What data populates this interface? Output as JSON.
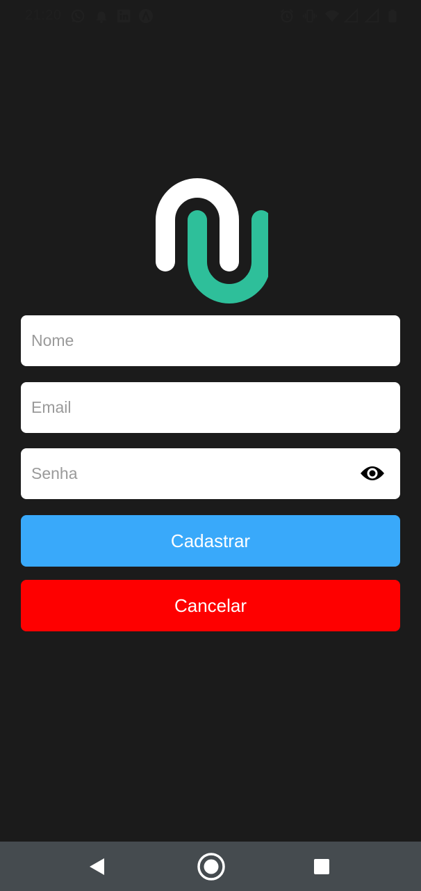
{
  "status_bar": {
    "time": "21:20",
    "left_icons": [
      "whatsapp-icon",
      "notification-bell-icon",
      "linkedin-icon",
      "app-a-icon"
    ],
    "right_icons": [
      "alarm-icon",
      "vibrate-icon",
      "wifi-icon",
      "signal-icon",
      "signal-icon",
      "battery-icon"
    ]
  },
  "logo": {
    "icon": "app-logo-icon",
    "colors": {
      "white_arch": "#ffffff",
      "green_u": "#2ebf9a"
    }
  },
  "form": {
    "name_placeholder": "Nome",
    "email_placeholder": "Email",
    "password_placeholder": "Senha",
    "name_value": "",
    "email_value": "",
    "password_value": "",
    "show_password_icon": "eye-icon"
  },
  "buttons": {
    "register_label": "Cadastrar",
    "cancel_label": "Cancelar",
    "register_color": "#39a9fa",
    "cancel_color": "#fe0000"
  },
  "nav_bar": {
    "back_icon": "back-triangle-icon",
    "home_icon": "home-circle-icon",
    "recents_icon": "recents-square-icon"
  }
}
